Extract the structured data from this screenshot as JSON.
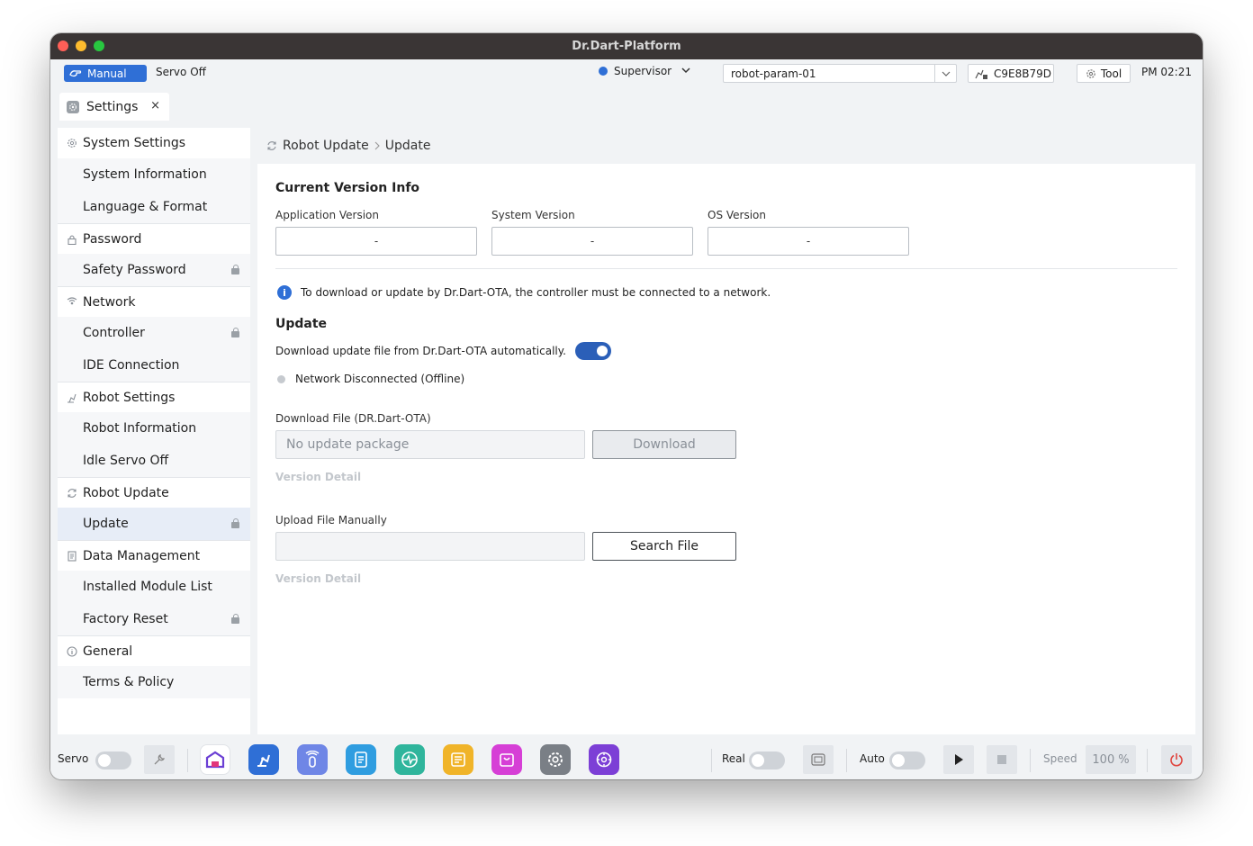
{
  "window": {
    "title": "Dr.Dart-Platform"
  },
  "topbar": {
    "mode": "Manual",
    "servo_state": "Servo Off",
    "role": "Supervisor",
    "robot_param": "robot-param-01",
    "serial": "C9E8B79D",
    "tool_label": "Tool",
    "time": "PM 02:21"
  },
  "tab": {
    "label": "Settings",
    "close": "×"
  },
  "sidebar": {
    "groups": [
      {
        "label": "System Settings",
        "icon": "gear-icon",
        "items": [
          {
            "label": "System Information",
            "locked": false
          },
          {
            "label": "Language & Format",
            "locked": false
          }
        ]
      },
      {
        "label": "Password",
        "icon": "lock-icon",
        "items": [
          {
            "label": "Safety Password",
            "locked": true
          }
        ]
      },
      {
        "label": "Network",
        "icon": "network-icon",
        "items": [
          {
            "label": "Controller",
            "locked": true
          },
          {
            "label": "IDE Connection",
            "locked": false
          }
        ]
      },
      {
        "label": "Robot Settings",
        "icon": "robot-arm-icon",
        "items": [
          {
            "label": "Robot Information",
            "locked": false
          },
          {
            "label": "Idle Servo Off",
            "locked": false
          }
        ]
      },
      {
        "label": "Robot Update",
        "icon": "refresh-icon",
        "items": [
          {
            "label": "Update",
            "locked": true,
            "active": true
          }
        ]
      },
      {
        "label": "Data Management",
        "icon": "document-icon",
        "items": [
          {
            "label": "Installed Module List",
            "locked": false
          },
          {
            "label": "Factory Reset",
            "locked": true
          }
        ]
      },
      {
        "label": "General",
        "icon": "info-icon",
        "items": [
          {
            "label": "Terms & Policy",
            "locked": false
          }
        ]
      }
    ]
  },
  "main": {
    "breadcrumb": {
      "parent": "Robot Update",
      "current": "Update"
    },
    "version_info": {
      "title": "Current Version Info",
      "app_label": "Application Version",
      "app_value": "-",
      "sys_label": "System Version",
      "sys_value": "-",
      "os_label": "OS Version",
      "os_value": "-"
    },
    "notice": "To download or update by Dr.Dart-OTA, the controller must be connected to a network.",
    "update": {
      "title": "Update",
      "auto_label": "Download update file from Dr.Dart-OTA automatically.",
      "network_status": "Network Disconnected (Offline)",
      "download_label": "Download File (DR.Dart-OTA)",
      "download_placeholder": "No update package",
      "download_button": "Download",
      "version_detail": "Version Detail",
      "upload_label": "Upload File Manually",
      "search_button": "Search File",
      "version_detail_2": "Version Detail"
    }
  },
  "bottombar": {
    "servo_label": "Servo",
    "real_label": "Real",
    "auto_label": "Auto",
    "speed_label": "Speed",
    "speed_value": "100",
    "speed_unit": "%"
  },
  "colors": {
    "accent": "#2f6fd6",
    "toggle_on": "#2b5fb8",
    "active_item": "#e7edf7"
  }
}
